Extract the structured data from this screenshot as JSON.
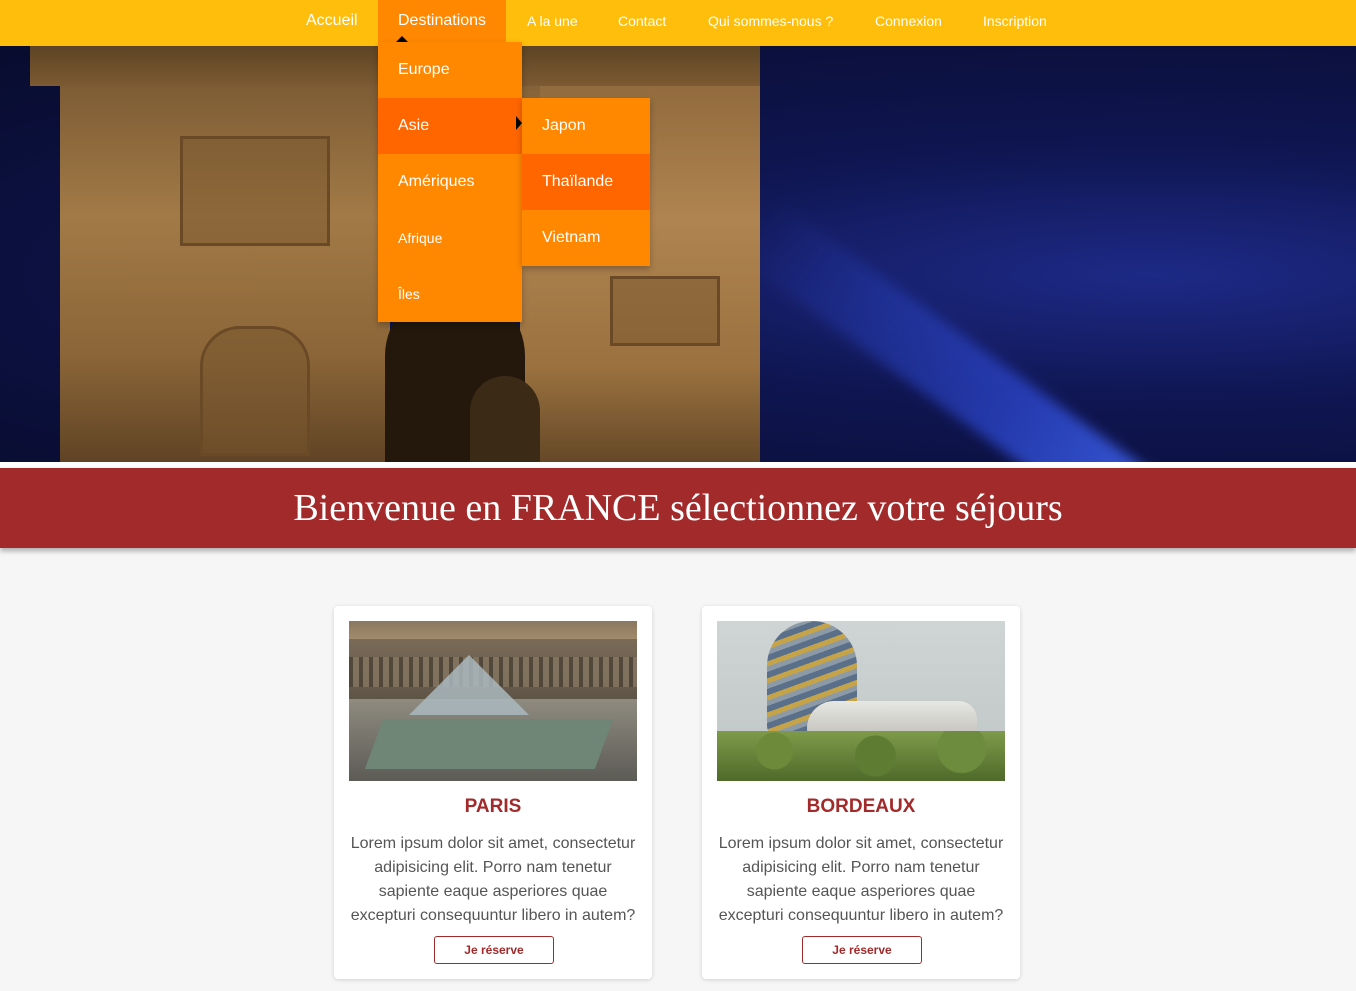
{
  "nav": {
    "items": [
      "Accueil",
      "Destinations",
      "A la une",
      "Contact",
      "Qui sommes-nous ?",
      "Connexion",
      "Inscription"
    ],
    "active": "Destinations"
  },
  "dropdown": {
    "items": [
      "Europe",
      "Asie",
      "Amériques",
      "Afrique",
      "Îles"
    ],
    "highlighted": "Asie",
    "submenu": {
      "items": [
        "Japon",
        "Thaïlande",
        "Vietnam"
      ],
      "highlighted": "Thaïlande"
    }
  },
  "banner": {
    "title": "Bienvenue en FRANCE sélectionnez votre séjours"
  },
  "cards": [
    {
      "title": "PARIS",
      "text": "Lorem ipsum dolor sit amet, consectetur adipisicing elit. Porro nam tenetur sapiente eaque asperiores quae excepturi consequuntur libero in autem?",
      "button": "Je réserve"
    },
    {
      "title": "BORDEAUX",
      "text": "Lorem ipsum dolor sit amet, consectetur adipisicing elit. Porro nam tenetur sapiente eaque asperiores quae excepturi consequuntur libero in autem?",
      "button": "Je réserve"
    }
  ],
  "colors": {
    "nav_bg": "#ffbe0b",
    "menu_bg": "#ff8800",
    "menu_highlight": "#ff6600",
    "banner_bg": "#a32a2a",
    "card_accent": "#a32a2a"
  },
  "icons": {
    "nav_caret": "caret-up-icon",
    "submenu_arrow": "chevron-right-icon"
  }
}
